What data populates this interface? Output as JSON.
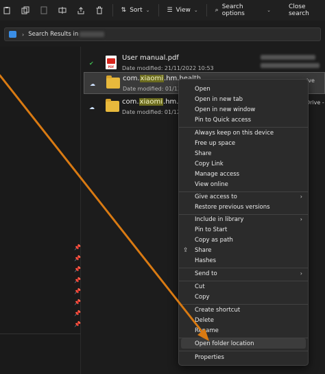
{
  "toolbar": {
    "sort_label": "Sort",
    "view_label": "View",
    "search_options_label": "Search options",
    "close_search_label": "Close search"
  },
  "address": {
    "path_text": "Search Results in"
  },
  "files": [
    {
      "name": "User manual.pdf",
      "name_pre": "User manual.pdf",
      "name_hl": "",
      "name_post": "",
      "date": "Date modified: 21/11/2022 10:53",
      "type": "pdf",
      "status": "synced"
    },
    {
      "name_pre": "com.",
      "name_hl": "xiaomi",
      "name_post": ".hm.health",
      "date": "Date modified: 01/12/",
      "type": "folder",
      "status": "cloud",
      "selected": true
    },
    {
      "name_pre": "com.",
      "name_hl": "xiaomi",
      "name_post": ".hm.he",
      "date": "Date modified: 01/12/",
      "type": "folder",
      "status": "cloud",
      "side_text": "Drive -"
    }
  ],
  "row1_side_text": "ive",
  "menu": {
    "group1": [
      "Open",
      "Open in new tab",
      "Open in new window",
      "Pin to Quick access"
    ],
    "group2": [
      "Always keep on this device",
      "Free up space",
      "Share",
      "Copy Link",
      "Manage access",
      "View online"
    ],
    "group3": [
      "Give access to",
      "Restore previous versions"
    ],
    "group4": [
      "Include in library",
      "Pin to Start",
      "Copy as path",
      "Share",
      "Hashes"
    ],
    "group5": [
      "Send to"
    ],
    "group6": [
      "Cut",
      "Copy"
    ],
    "group7": [
      "Create shortcut",
      "Delete",
      "Rename"
    ],
    "group8": [
      "Open folder location"
    ],
    "group9": [
      "Properties"
    ]
  },
  "colors": {
    "arrow": "#d97a12",
    "highlight": "#6b6b1e",
    "folder": "#e8b93c",
    "accent": "#3a8ee6"
  }
}
